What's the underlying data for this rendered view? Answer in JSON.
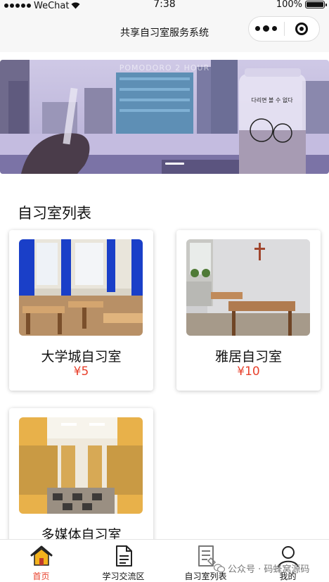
{
  "status_bar": {
    "carrier": "WeChat",
    "time": "7:38",
    "battery": "100%",
    "signal_level": 1.0
  },
  "navbar": {
    "title": "共享自习室服务系统",
    "more_icon": "more-dots-icon",
    "close_icon": "target-close-icon"
  },
  "banner": {
    "caption": "POMODORO 2 HOUR",
    "can_text": "다리면 볼 수 없다",
    "colors": {
      "sky": "#b9b3d6",
      "water": "#c8bfe0",
      "table": "#6b6494"
    }
  },
  "section": {
    "title": "自习室列表"
  },
  "rooms": [
    {
      "name": "大学城自习室",
      "price": "¥5"
    },
    {
      "name": "雅居自习室",
      "price": "¥10"
    },
    {
      "name": "多媒体自习室",
      "price": ""
    }
  ],
  "tabbar": {
    "tabs": [
      {
        "label": "首页",
        "icon": "home-icon",
        "active": true
      },
      {
        "label": "学习交流区",
        "icon": "document-icon",
        "active": false
      },
      {
        "label": "自习室列表",
        "icon": "list-document-icon",
        "active": false
      },
      {
        "label": "我的",
        "icon": "user-icon",
        "active": false
      }
    ]
  },
  "watermark": {
    "text": "公众号 · 码蜂窝源码"
  },
  "colors": {
    "accent": "#e8412c",
    "background": "#f7f7f7"
  }
}
